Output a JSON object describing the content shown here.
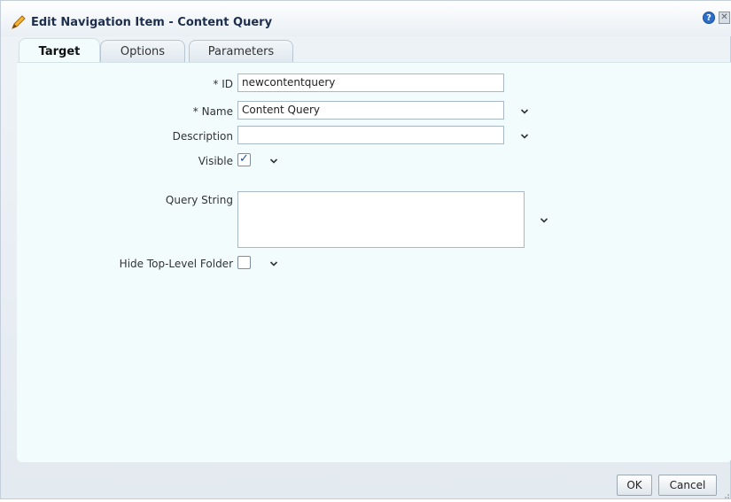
{
  "dialog": {
    "title": "Edit Navigation Item - Content Query",
    "help_glyph": "?",
    "close_glyph": "✕"
  },
  "tabs": [
    {
      "label": "Target",
      "active": true
    },
    {
      "label": "Options",
      "active": false
    },
    {
      "label": "Parameters",
      "active": false
    }
  ],
  "form": {
    "id": {
      "label": "* ID",
      "value": "newcontentquery"
    },
    "name": {
      "label": "* Name",
      "value": "Content Query"
    },
    "description": {
      "label": "Description",
      "value": ""
    },
    "visible": {
      "label": "Visible",
      "checked": true,
      "check_glyph": "✓"
    },
    "query_string": {
      "label": "Query String",
      "value": ""
    },
    "hide_top_level_folder": {
      "label": "Hide Top-Level Folder",
      "checked": false
    }
  },
  "buttons": {
    "ok": "OK",
    "cancel": "Cancel"
  },
  "colors": {
    "title_text": "#1d2f4d",
    "content_background": "#f2fcfd",
    "check_color": "#1f4fa0",
    "help_blue": "#2d6ec9"
  },
  "icons": [
    "pencil-icon",
    "help-icon",
    "close-icon",
    "chevron-down-icon",
    "resize-grip-icon"
  ]
}
